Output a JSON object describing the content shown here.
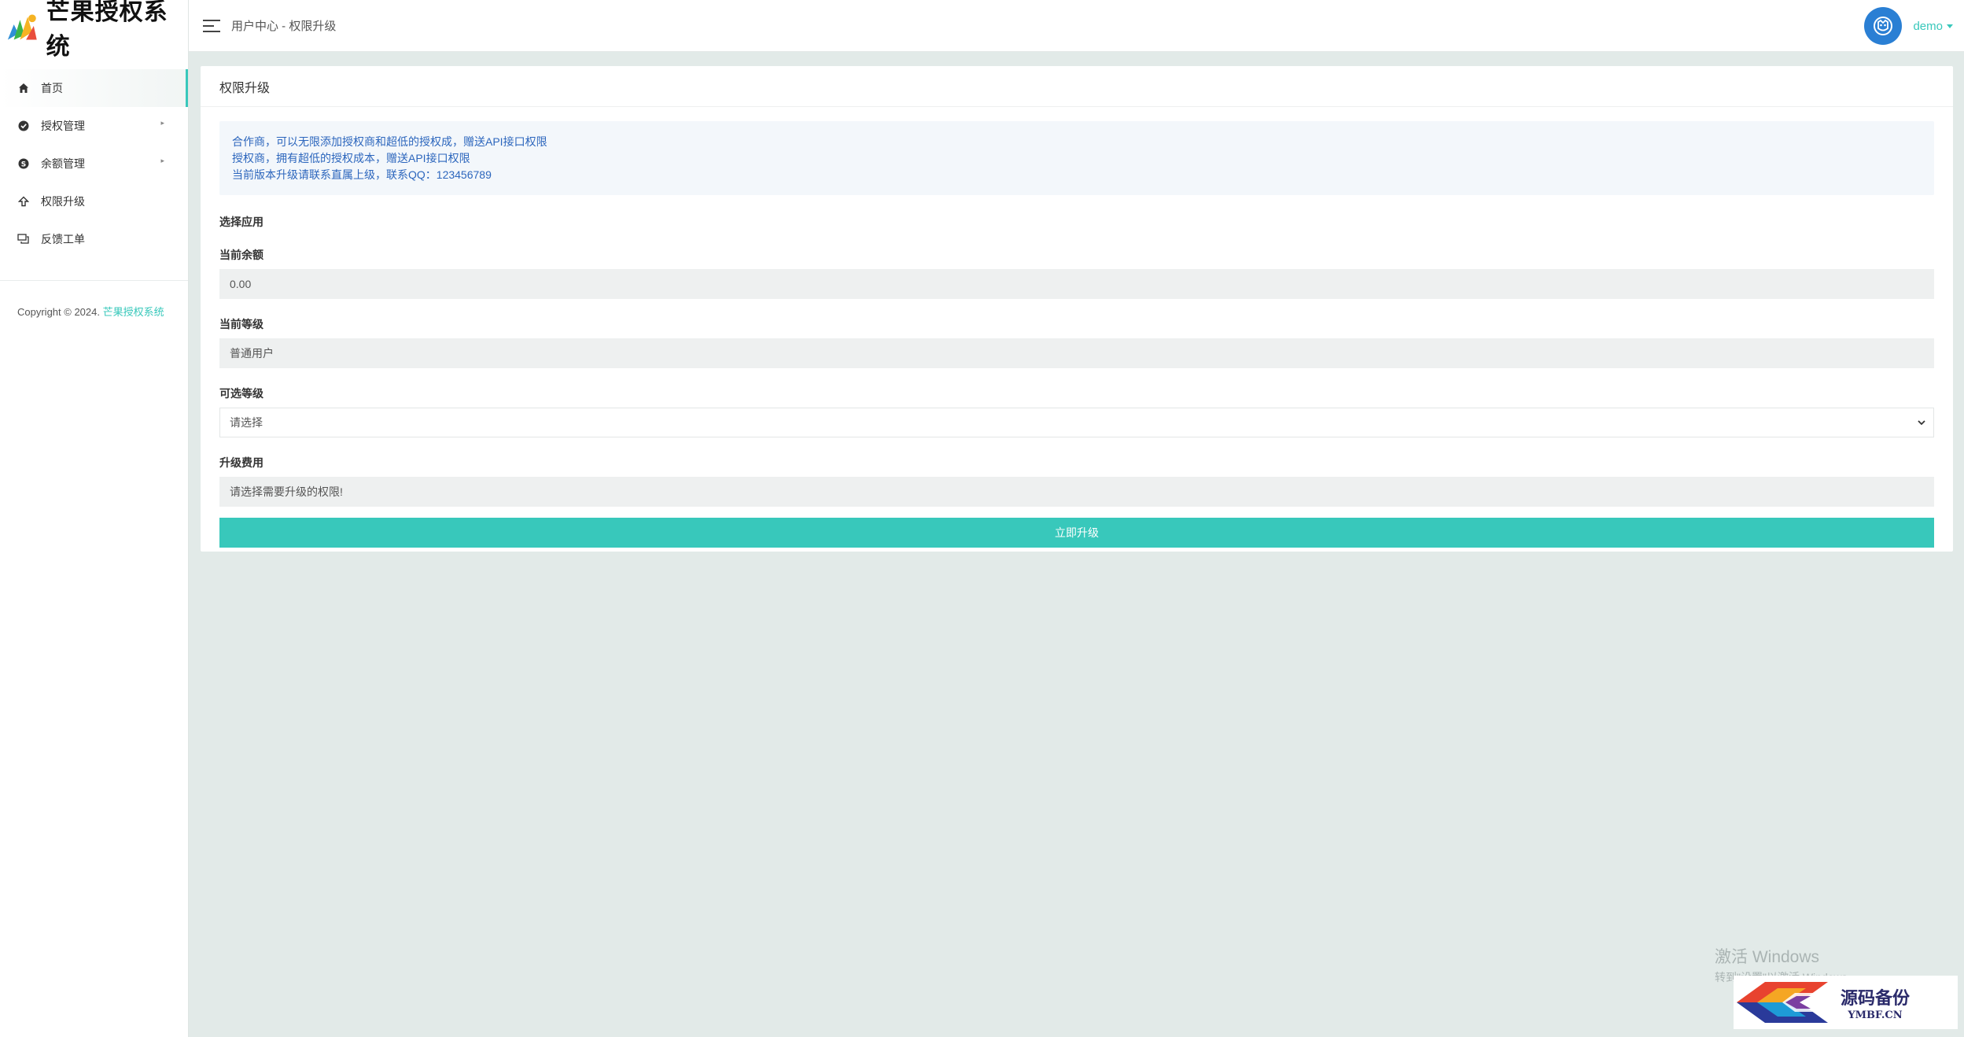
{
  "app": {
    "name": "芒果授权系统"
  },
  "sidebar": {
    "items": [
      {
        "label": "首页",
        "icon": "home-icon",
        "active": true
      },
      {
        "label": "授权管理",
        "icon": "check-circle-icon",
        "has_submenu": true
      },
      {
        "label": "余额管理",
        "icon": "skype-icon",
        "has_submenu": true
      },
      {
        "label": "权限升级",
        "icon": "arrow-up-icon"
      },
      {
        "label": "反馈工单",
        "icon": "chat-icon"
      }
    ],
    "copyright_prefix": "Copyright © 2024.",
    "copyright_brand": "芒果授权系统"
  },
  "header": {
    "breadcrumb": "用户中心 - 权限升级",
    "username": "demo"
  },
  "card": {
    "title": "权限升级",
    "notice": [
      "合作商，可以无限添加授权商和超低的授权成，赠送API接口权限",
      "授权商，拥有超低的授权成本，赠送API接口权限",
      "当前版本升级请联系直属上级，联系QQ：123456789"
    ],
    "select_app_label": "选择应用",
    "balance_label": "当前余额",
    "balance_value": "0.00",
    "level_label": "当前等级",
    "level_value": "普通用户",
    "options_label": "可选等级",
    "options_selected": "请选择",
    "fee_label": "升级费用",
    "fee_value": "请选择需要升级的权限!",
    "submit_label": "立即升级"
  },
  "watermark": {
    "windows_title": "激活 Windows",
    "windows_sub": "转到\"设置\"以激活 Windows。",
    "site_cn": "源码备份",
    "site_en": "YMBF.CN"
  },
  "colors": {
    "accent": "#38c8bb",
    "notice_text": "#2c66bd",
    "avatar_bg": "#2a7fd4"
  }
}
